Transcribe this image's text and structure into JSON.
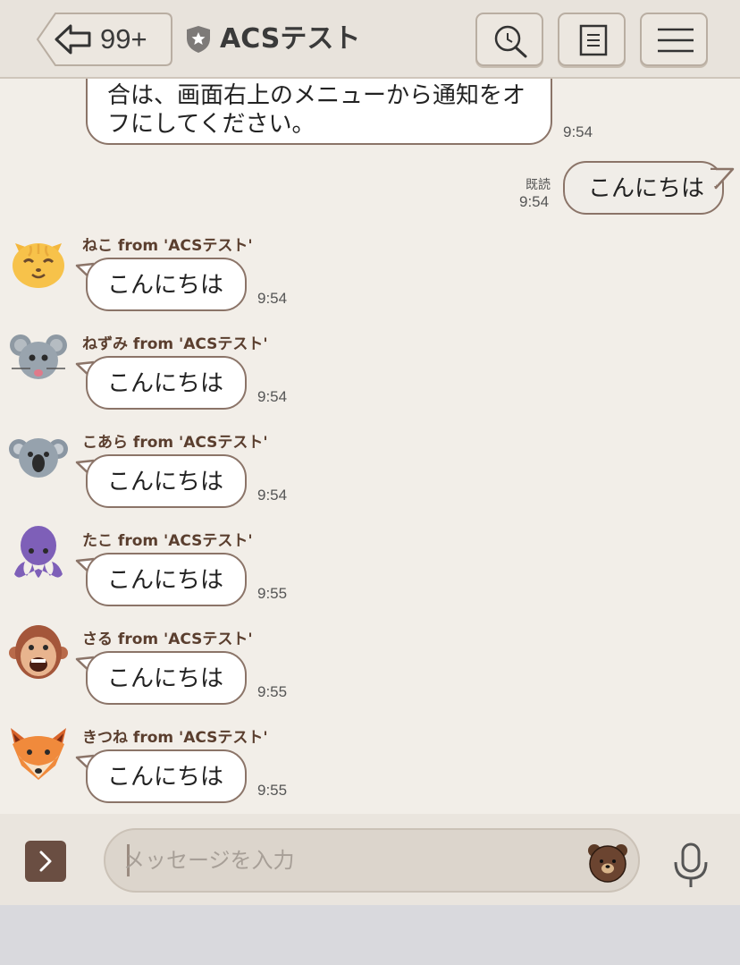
{
  "header": {
    "back_count": "99+",
    "title": "ACSテスト",
    "icons": [
      "back-arrow-icon",
      "shield-star-icon",
      "search-icon",
      "notes-icon",
      "menu-icon"
    ]
  },
  "messages": {
    "system_partial": {
      "line1": "合は、画面右上のメニューから通知をオ",
      "line2": "フにしてください。",
      "time": "9:54"
    },
    "own": {
      "read_label": "既読",
      "time": "9:54",
      "text": "こんにちは"
    },
    "incoming": [
      {
        "sender": "ねこ from 'ACSテスト'",
        "text": "こんにちは",
        "time": "9:54",
        "avatar": "cat-avatar"
      },
      {
        "sender": "ねずみ from 'ACSテスト'",
        "text": "こんにちは",
        "time": "9:54",
        "avatar": "mouse-avatar"
      },
      {
        "sender": "こあら from 'ACSテスト'",
        "text": "こんにちは",
        "time": "9:54",
        "avatar": "koala-avatar"
      },
      {
        "sender": "たこ from 'ACSテスト'",
        "text": "こんにちは",
        "time": "9:55",
        "avatar": "octopus-avatar"
      },
      {
        "sender": "さる from 'ACSテスト'",
        "text": "こんにちは",
        "time": "9:55",
        "avatar": "monkey-avatar"
      },
      {
        "sender": "きつね from 'ACSテスト'",
        "text": "こんにちは",
        "time": "9:55",
        "avatar": "fox-avatar"
      }
    ]
  },
  "input_bar": {
    "placeholder": "メッセージを入力",
    "value": ""
  },
  "colors": {
    "header_bg": "#e8e3dc",
    "chat_bg": "#f2eee8",
    "bubble_border": "#8b7468",
    "sender_text": "#5a3e2e",
    "expand_button": "#6a4e42"
  }
}
